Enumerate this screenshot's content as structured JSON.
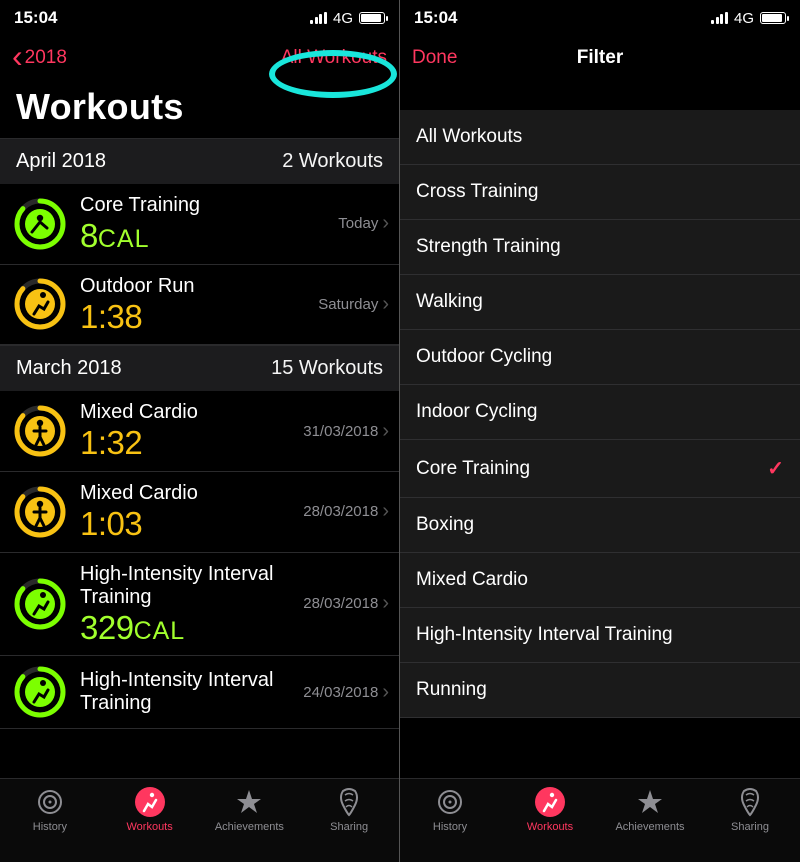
{
  "status": {
    "time": "15:04",
    "network": "4G"
  },
  "left": {
    "nav": {
      "back_label": "2018",
      "right_label": "All Workouts"
    },
    "title": "Workouts",
    "sections": [
      {
        "header": "April 2018",
        "count": "2 Workouts",
        "rows": [
          {
            "name": "Core Training",
            "metric_value": "8",
            "metric_unit": "CAL",
            "color": "green",
            "date": "Today",
            "icon": "core",
            "ring_color": "#7cff00"
          },
          {
            "name": "Outdoor Run",
            "metric_value": "1:38",
            "metric_unit": "",
            "color": "yellow",
            "date": "Saturday",
            "icon": "run",
            "ring_color": "#f8c213"
          }
        ]
      },
      {
        "header": "March 2018",
        "count": "15 Workouts",
        "rows": [
          {
            "name": "Mixed Cardio",
            "metric_value": "1:32",
            "metric_unit": "",
            "color": "yellow",
            "date": "31/03/2018",
            "icon": "cardio",
            "ring_color": "#f8c213"
          },
          {
            "name": "Mixed Cardio",
            "metric_value": "1:03",
            "metric_unit": "",
            "color": "yellow",
            "date": "28/03/2018",
            "icon": "cardio",
            "ring_color": "#f8c213"
          },
          {
            "name": "High-Intensity Interval Training",
            "metric_value": "329",
            "metric_unit": "CAL",
            "color": "green",
            "date": "28/03/2018",
            "icon": "run",
            "ring_color": "#7cff00"
          },
          {
            "name": "High-Intensity Interval Training",
            "metric_value": "",
            "metric_unit": "",
            "color": "green",
            "date": "24/03/2018",
            "icon": "run",
            "ring_color": "#7cff00"
          }
        ]
      }
    ],
    "tabs": [
      {
        "label": "History",
        "icon": "history"
      },
      {
        "label": "Workouts",
        "icon": "workouts"
      },
      {
        "label": "Achievements",
        "icon": "achievements"
      },
      {
        "label": "Sharing",
        "icon": "sharing"
      }
    ],
    "active_tab": 1
  },
  "right": {
    "nav": {
      "done_label": "Done",
      "title": "Filter"
    },
    "filters": [
      {
        "label": "All Workouts",
        "selected": false
      },
      {
        "label": "Cross Training",
        "selected": false
      },
      {
        "label": "Strength Training",
        "selected": false
      },
      {
        "label": "Walking",
        "selected": false
      },
      {
        "label": "Outdoor Cycling",
        "selected": false
      },
      {
        "label": "Indoor Cycling",
        "selected": false
      },
      {
        "label": "Core Training",
        "selected": true
      },
      {
        "label": "Boxing",
        "selected": false
      },
      {
        "label": "Mixed Cardio",
        "selected": false
      },
      {
        "label": "High-Intensity Interval Training",
        "selected": false
      },
      {
        "label": "Running",
        "selected": false
      }
    ],
    "tabs_ref": "left.tabs",
    "active_tab": 1
  }
}
